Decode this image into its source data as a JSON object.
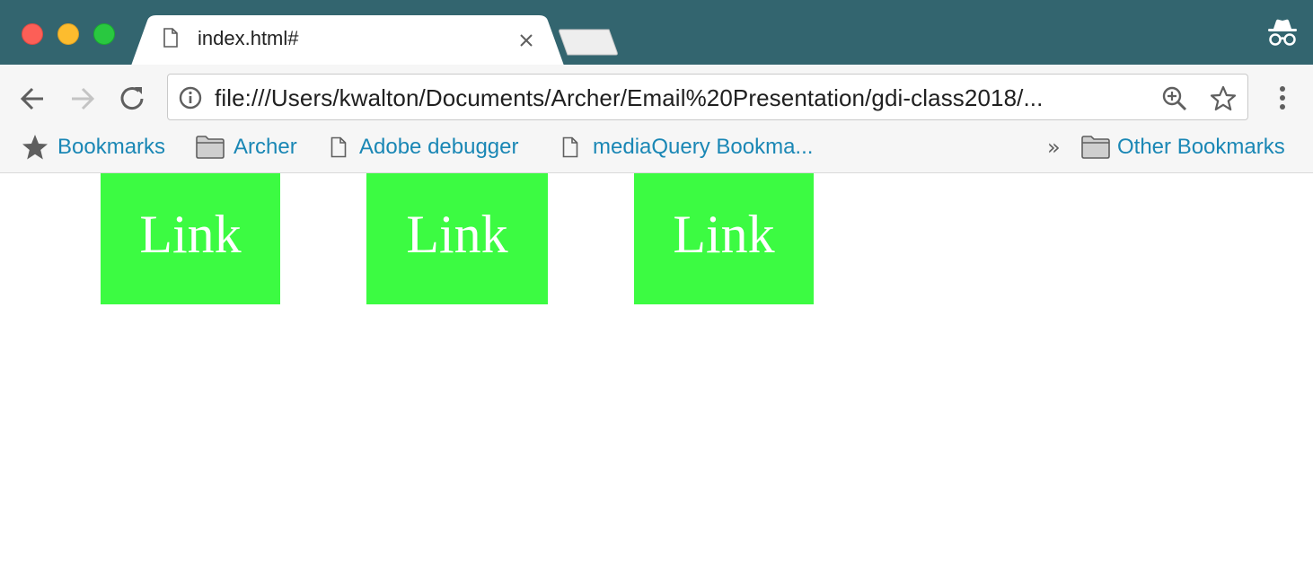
{
  "window": {
    "traffic_lights": [
      "close",
      "minimize",
      "maximize"
    ],
    "frame_color": "#33656f"
  },
  "tab": {
    "title": "index.html#",
    "favicon": "document-icon"
  },
  "toolbar": {
    "url": "file:///Users/kwalton/Documents/Archer/Email%20Presentation/gdi-class2018/...",
    "icons": [
      "back-icon",
      "forward-icon",
      "reload-icon",
      "info-icon",
      "zoom-icon",
      "star-icon",
      "menu-icon"
    ]
  },
  "bookmarks": {
    "items": [
      {
        "label": "Bookmarks",
        "icon": "star-icon"
      },
      {
        "label": "Archer",
        "icon": "folder-icon"
      },
      {
        "label": "Adobe debugger",
        "icon": "document-icon"
      },
      {
        "label": "mediaQuery Bookma...",
        "icon": "document-icon"
      }
    ],
    "overflow": "»",
    "other": {
      "label": "Other Bookmarks",
      "icon": "folder-icon"
    },
    "link_color": "#1a87b5"
  },
  "page": {
    "links": [
      {
        "label": "Link"
      },
      {
        "label": "Link"
      },
      {
        "label": "Link"
      }
    ],
    "link_bg": "#3cfb42",
    "link_color": "#ffffff"
  }
}
